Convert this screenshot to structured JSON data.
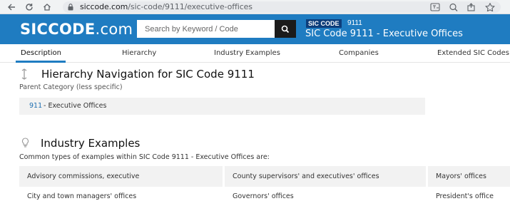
{
  "browser": {
    "url_host": "siccode.com",
    "url_path": "/sic-code/9111/executive-offices"
  },
  "site": {
    "logo_bold": "SICCODE",
    "logo_suffix": ".com",
    "search_placeholder": "Search by Keyword / Code",
    "badge": "SIC CODE",
    "code": "9111",
    "title": "SIC Code 9111 - Executive Offices"
  },
  "tabs": [
    {
      "label": "Description"
    },
    {
      "label": "Hierarchy"
    },
    {
      "label": "Industry Examples"
    },
    {
      "label": "Companies"
    },
    {
      "label": "Extended SIC Codes"
    }
  ],
  "hierarchy": {
    "heading": "Hierarchy Navigation for SIC Code 9111",
    "subheading": "Parent Category (less specific)",
    "parent_code": "911",
    "parent_desc": "- Executive Offices"
  },
  "examples": {
    "heading": "Industry Examples",
    "intro": "Common types of examples within SIC Code 9111 - Executive Offices are:",
    "rows": [
      [
        "Advisory commissions, executive",
        "County supervisors' and executives' offices",
        "Mayors' offices"
      ],
      [
        "City and town managers' offices",
        "Governors' offices",
        "President's office"
      ]
    ]
  },
  "colors": {
    "brand": "#1f7cc1",
    "link": "#1f6fb2"
  }
}
